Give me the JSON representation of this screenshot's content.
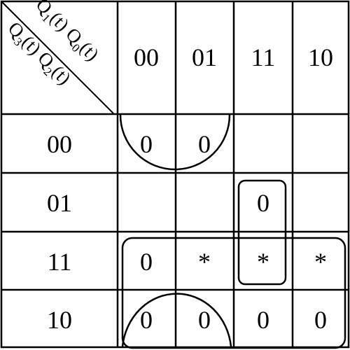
{
  "corner": {
    "top": "Q1(t) Q0(t)",
    "bottom": "Q3(t) Q2(t)",
    "top_parts": [
      "Q",
      "1",
      "(t) Q",
      "0",
      "(t)"
    ],
    "bottom_parts": [
      "Q",
      "3",
      "(t) Q",
      "2",
      "(t)"
    ]
  },
  "columns": [
    "00",
    "01",
    "11",
    "10"
  ],
  "rows": [
    "00",
    "01",
    "11",
    "10"
  ],
  "cells": [
    [
      "0",
      "0",
      "",
      ""
    ],
    [
      "",
      "",
      "0",
      ""
    ],
    [
      "0",
      "*",
      "*",
      "*"
    ],
    [
      "0",
      "0",
      "0",
      "0"
    ]
  ]
}
